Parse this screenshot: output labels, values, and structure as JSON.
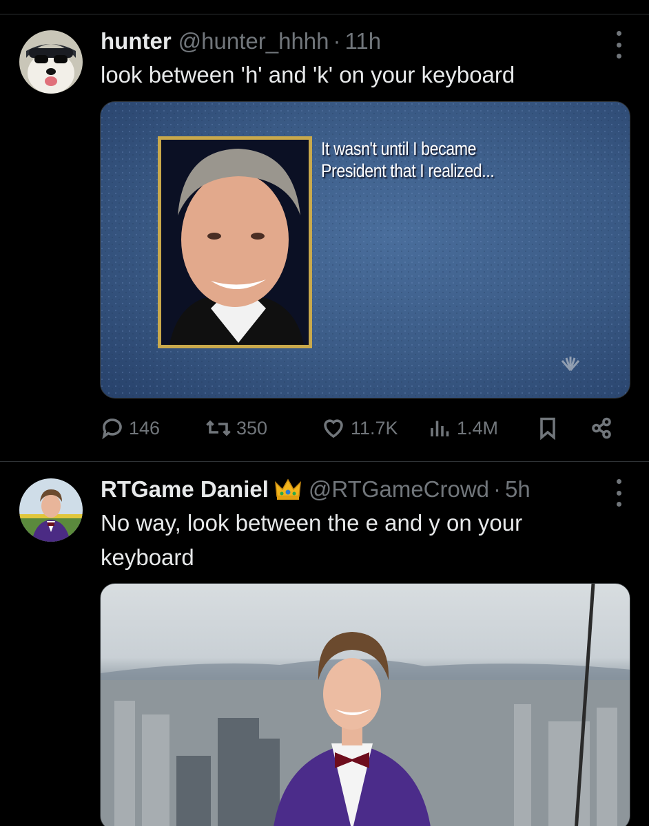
{
  "colors": {
    "background": "#000000",
    "text": "#e7e9ea",
    "muted": "#71767b",
    "divider": "#2f3336"
  },
  "posts": [
    {
      "name": "hunter",
      "handle": "@hunter_hhhh",
      "sep": "·",
      "time": "11h",
      "text": "look between 'h' and 'k' on your keyboard",
      "media": {
        "caption_line1": "It wasn't until I became",
        "caption_line2": "President that I realized...",
        "network_logo": "nbc-peacock-icon"
      },
      "stats": {
        "replies": "146",
        "reposts": "350",
        "likes": "11.7K",
        "views": "1.4M"
      },
      "icons": [
        "reply-icon",
        "repost-icon",
        "like-icon",
        "views-icon",
        "bookmark-icon",
        "share-icon"
      ]
    },
    {
      "name": "RTGame Daniel",
      "badge": "crown-icon",
      "handle": "@RTGameCrowd",
      "sep": "·",
      "time": "5h",
      "text": "No way, look between the e and y on your keyboard"
    }
  ]
}
